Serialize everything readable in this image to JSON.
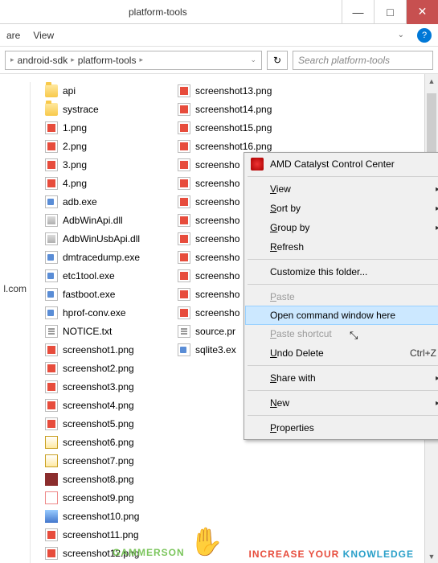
{
  "window": {
    "title": "platform-tools",
    "min": "—",
    "max": "□",
    "close": "✕"
  },
  "menu": {
    "share": "are",
    "view": "View",
    "help": "?",
    "chev": "⌄"
  },
  "addr": {
    "crumb1": "android-sdk",
    "crumb2": "platform-tools",
    "sep": "▸",
    "dropdown": "⌄",
    "refresh": "↻",
    "search_placeholder": "Search platform-tools",
    "search_icon": "🔍"
  },
  "left_labels": {
    "a": "",
    "b": "l.com"
  },
  "col1": [
    {
      "icon": "folder",
      "name": "api"
    },
    {
      "icon": "folder",
      "name": "systrace"
    },
    {
      "icon": "png",
      "name": "1.png"
    },
    {
      "icon": "png",
      "name": "2.png"
    },
    {
      "icon": "png",
      "name": "3.png"
    },
    {
      "icon": "png",
      "name": "4.png"
    },
    {
      "icon": "exe",
      "name": "adb.exe"
    },
    {
      "icon": "dll",
      "name": "AdbWinApi.dll"
    },
    {
      "icon": "dll",
      "name": "AdbWinUsbApi.dll"
    },
    {
      "icon": "exe",
      "name": "dmtracedump.exe"
    },
    {
      "icon": "exe",
      "name": "etc1tool.exe"
    },
    {
      "icon": "exe",
      "name": "fastboot.exe"
    },
    {
      "icon": "exe",
      "name": "hprof-conv.exe"
    },
    {
      "icon": "txt",
      "name": "NOTICE.txt"
    },
    {
      "icon": "png",
      "name": "screenshot1.png"
    },
    {
      "icon": "png",
      "name": "screenshot2.png"
    },
    {
      "icon": "png",
      "name": "screenshot3.png"
    },
    {
      "icon": "png",
      "name": "screenshot4.png"
    },
    {
      "icon": "png",
      "name": "screenshot5.png"
    },
    {
      "icon": "misc1",
      "name": "screenshot6.png"
    },
    {
      "icon": "misc1",
      "name": "screenshot7.png"
    },
    {
      "icon": "misc2",
      "name": "screenshot8.png"
    },
    {
      "icon": "misc3",
      "name": "screenshot9.png"
    },
    {
      "icon": "misc4",
      "name": "screenshot10.png"
    },
    {
      "icon": "png",
      "name": "screenshot11.png"
    },
    {
      "icon": "png",
      "name": "screenshot12.png"
    }
  ],
  "col2": [
    {
      "icon": "png",
      "name": "screenshot13.png"
    },
    {
      "icon": "png",
      "name": "screenshot14.png"
    },
    {
      "icon": "png",
      "name": "screenshot15.png"
    },
    {
      "icon": "png",
      "name": "screenshot16.png"
    },
    {
      "icon": "png",
      "name": "screensho"
    },
    {
      "icon": "png",
      "name": "screensho"
    },
    {
      "icon": "png",
      "name": "screensho"
    },
    {
      "icon": "png",
      "name": "screensho"
    },
    {
      "icon": "png",
      "name": "screensho"
    },
    {
      "icon": "png",
      "name": "screensho"
    },
    {
      "icon": "png",
      "name": "screensho"
    },
    {
      "icon": "png",
      "name": "screensho"
    },
    {
      "icon": "png",
      "name": "screensho"
    },
    {
      "icon": "txt",
      "name": "source.pr"
    },
    {
      "icon": "exe",
      "name": "sqlite3.ex"
    }
  ],
  "ctx": {
    "amd": "AMD Catalyst Control Center",
    "view": "View",
    "sortby": "Sort by",
    "groupby": "Group by",
    "refresh": "Refresh",
    "customize": "Customize this folder...",
    "paste": "Paste",
    "opencmd": "Open command window here",
    "pastesc": "Paste shortcut",
    "undo": "Undo Delete",
    "undo_sc": "Ctrl+Z",
    "share": "Share with",
    "new": "New",
    "props": "Properties",
    "sub": "▸",
    "view_u": "V",
    "view_r": "iew",
    "sort_u": "S",
    "sort_r": "ort by",
    "group_u": "G",
    "group_r": "roup by",
    "refresh_u": "R",
    "refresh_r": "efresh",
    "paste_u": "P",
    "paste_r": "aste",
    "pastesc_u": "P",
    "pastesc_r": "aste shortcut",
    "undo_u": "U",
    "undo_r": "ndo Delete",
    "share_u": "S",
    "share_r": "hare with",
    "new_u": "N",
    "new_r": "ew",
    "props_u": "P",
    "props_r": "roperties"
  },
  "watermark": {
    "text": "GAMMERSON",
    "hand": "✋",
    "sub1": "INCREASE YOUR ",
    "sub2": "KNOWLEDGE"
  }
}
